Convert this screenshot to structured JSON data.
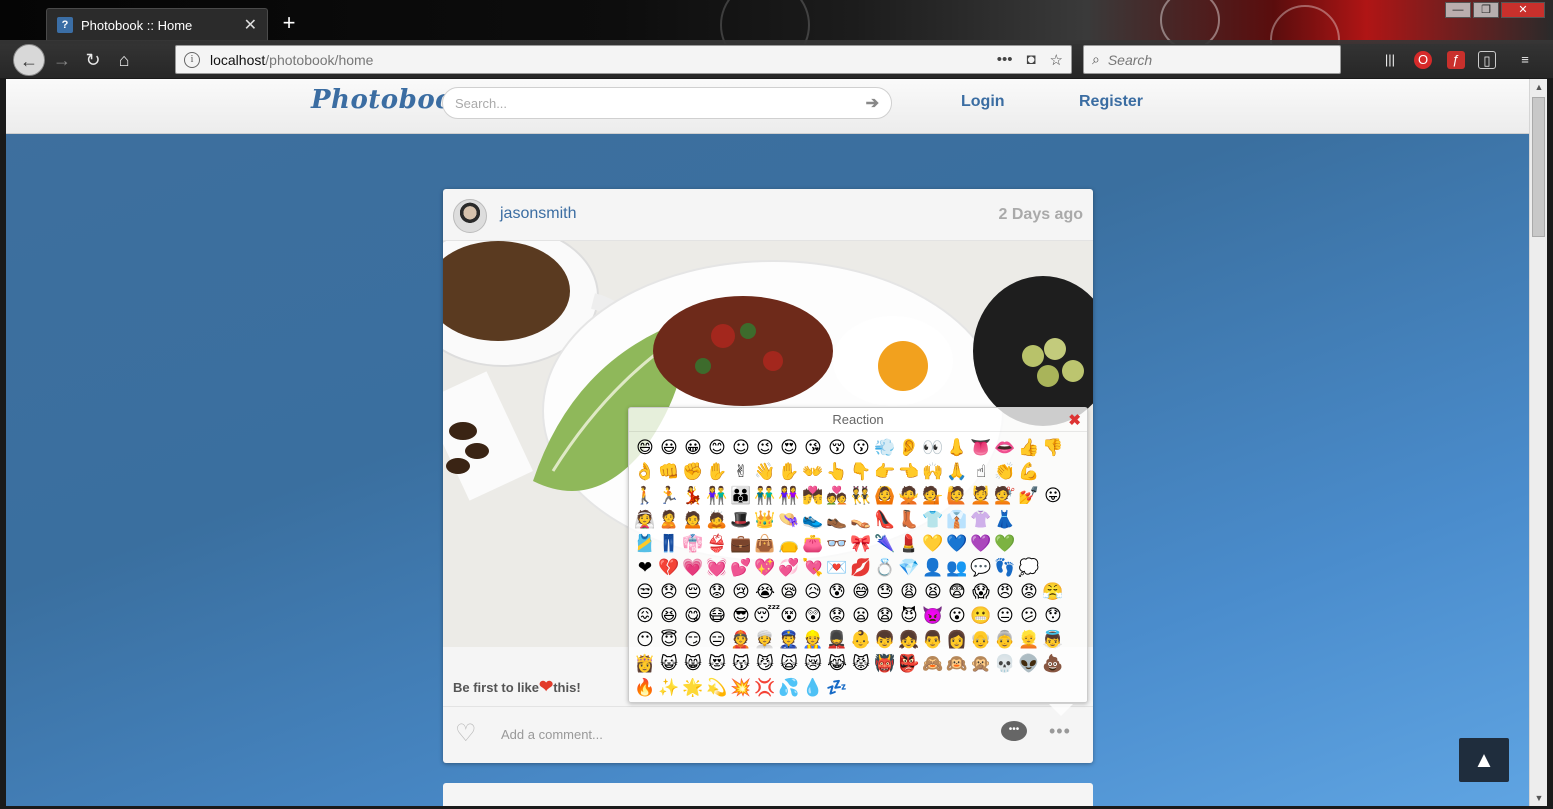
{
  "browser": {
    "tab_title": "Photobook :: Home",
    "tab_close": "✕",
    "new_tab": "+",
    "url_host": "localhost",
    "url_path": "/photobook/home",
    "search_placeholder": "Search",
    "window_buttons": [
      "—",
      "❐",
      "✕"
    ]
  },
  "site": {
    "logo": "Photobook",
    "search_placeholder": "Search...",
    "nav": {
      "login": "Login",
      "register": "Register"
    }
  },
  "post": {
    "username": "jasonsmith",
    "time_ago": "2 Days ago",
    "likes_prefix": "Be first to like",
    "likes_suffix": "this!",
    "comment_placeholder": "Add a comment...",
    "heart": "❤"
  },
  "reaction": {
    "title": "Reaction",
    "close": "✖",
    "rows": [
      [
        "😄",
        "😃",
        "😀",
        "😊",
        "☺",
        "😉",
        "😍",
        "😘",
        "😚",
        "😗",
        "💨",
        "👂",
        "👀",
        "👃",
        "👅",
        "👄",
        "👍",
        "👎"
      ],
      [
        "👌",
        "👊",
        "✊",
        "✋",
        "✌",
        "👋",
        "✋",
        "👐",
        "👆",
        "👇",
        "👉",
        "👈",
        "🙌",
        "🙏",
        "☝",
        "👏",
        "💪"
      ],
      [
        "🚶",
        "🏃",
        "💃",
        "👫",
        "👪",
        "👬",
        "👭",
        "💏",
        "💑",
        "👯",
        "🙆",
        "🙅",
        "💁",
        "🙋",
        "💆",
        "💇",
        "💅",
        "😛"
      ],
      [
        "👰",
        "🙎",
        "🙍",
        "🙇",
        "🎩",
        "👑",
        "👒",
        "👟",
        "👞",
        "👡",
        "👠",
        "👢",
        "👕",
        "👔",
        "👚",
        "👗"
      ],
      [
        "🎽",
        "👖",
        "👘",
        "👙",
        "💼",
        "👜",
        "👝",
        "👛",
        "👓",
        "🎀",
        "🌂",
        "💄",
        "💛",
        "💙",
        "💜",
        "💚"
      ],
      [
        "❤",
        "💔",
        "💗",
        "💓",
        "💕",
        "💖",
        "💞",
        "💘",
        "💌",
        "💋",
        "💍",
        "💎",
        "👤",
        "👥",
        "💬",
        "👣",
        "💭"
      ],
      [
        "😒",
        "😞",
        "😔",
        "😟",
        "😢",
        "😭",
        "😪",
        "😥",
        "😰",
        "😅",
        "😓",
        "😩",
        "😫",
        "😨",
        "😱",
        "😠",
        "😡",
        "😤"
      ],
      [
        "😖",
        "😆",
        "😋",
        "😷",
        "😎",
        "😴",
        "😵",
        "😲",
        "😟",
        "😦",
        "😧",
        "😈",
        "👿",
        "😮",
        "😬",
        "😐",
        "😕",
        "😯"
      ],
      [
        "😶",
        "😇",
        "😏",
        "😑",
        "👲",
        "👳",
        "👮",
        "👷",
        "💂",
        "👶",
        "👦",
        "👧",
        "👨",
        "👩",
        "👴",
        "👵",
        "👱",
        "👼"
      ],
      [
        "👸",
        "😺",
        "😸",
        "😻",
        "😽",
        "😼",
        "🙀",
        "😿",
        "😹",
        "😾",
        "👹",
        "👺",
        "🙈",
        "🙉",
        "🙊",
        "💀",
        "👽",
        "💩"
      ],
      [
        "🔥",
        "✨",
        "🌟",
        "💫",
        "💥",
        "💢",
        "💦",
        "💧",
        "💤"
      ]
    ]
  },
  "scroll_top": "▲",
  "colors": {
    "brand": "#3b6da2",
    "page_bg": "#3e6f9e",
    "like_heart": "#e23b2a"
  }
}
